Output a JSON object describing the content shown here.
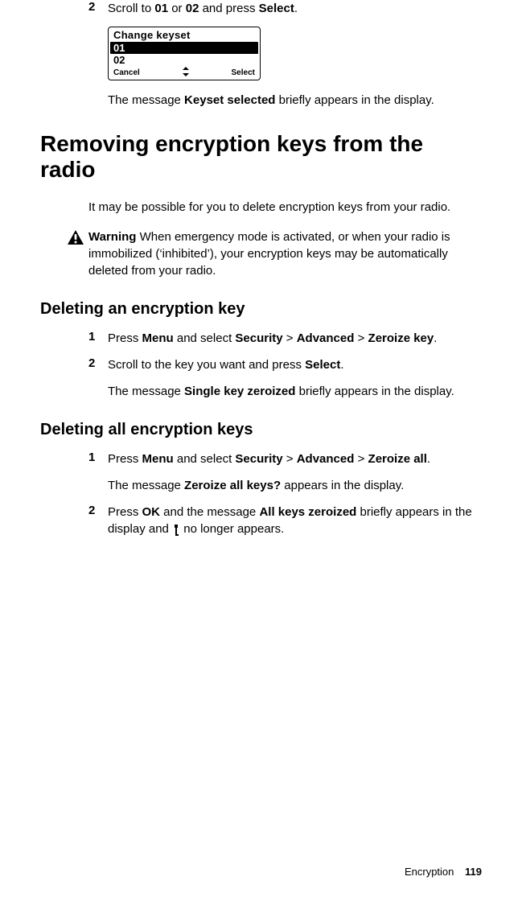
{
  "step2": {
    "num": "2",
    "pre": "Scroll to ",
    "b1": "01",
    "mid1": " or ",
    "b2": "02",
    "mid2": " and press ",
    "b3": "Select",
    "post": "."
  },
  "lcd": {
    "title": "Change keyset",
    "row1": "01",
    "row2": "02",
    "left": "Cancel",
    "right": "Select"
  },
  "post_lcd": {
    "pre": "The message ",
    "b": "Keyset selected",
    "post": " briefly appears in the display."
  },
  "h1": "Removing encryption keys from the radio",
  "intro": "It may be possible for you to delete encryption keys from your radio.",
  "warning": {
    "label": "Warning",
    "text": "  When emergency mode is activated, or when your radio is immobilized (‘inhibited’), your encryption keys may be automatically deleted from your radio."
  },
  "h2a": "Deleting an encryption key",
  "del_single": {
    "s1": {
      "num": "1",
      "pre": "Press ",
      "b1": "Menu",
      "mid1": " and select ",
      "b2": "Security",
      "gt1": " > ",
      "b3": "Advanced",
      "gt2": " > ",
      "b4": "Zeroize key",
      "post": "."
    },
    "s2": {
      "num": "2",
      "pre": "Scroll to the key you want and press ",
      "b1": "Select",
      "post": "."
    },
    "result": {
      "pre": "The message ",
      "b": "Single key zeroized",
      "post": " briefly appears in the display."
    }
  },
  "h2b": "Deleting all encryption keys",
  "del_all": {
    "s1": {
      "num": "1",
      "pre": "Press ",
      "b1": "Menu",
      "mid1": " and select ",
      "b2": "Security",
      "gt1": " > ",
      "b3": "Advanced",
      "gt2": " > ",
      "b4": "Zeroize all",
      "post": "."
    },
    "result1": {
      "pre": "The message ",
      "b": "Zeroize all keys?",
      "post": " appears in the display."
    },
    "s2": {
      "num": "2",
      "pre": "Press ",
      "b1": "OK",
      "mid1": " and the message ",
      "b2": "All keys zeroized",
      "mid2": " briefly appears in the display and ",
      "post": " no longer appears."
    }
  },
  "footer": {
    "section": "Encryption",
    "page": "119"
  }
}
